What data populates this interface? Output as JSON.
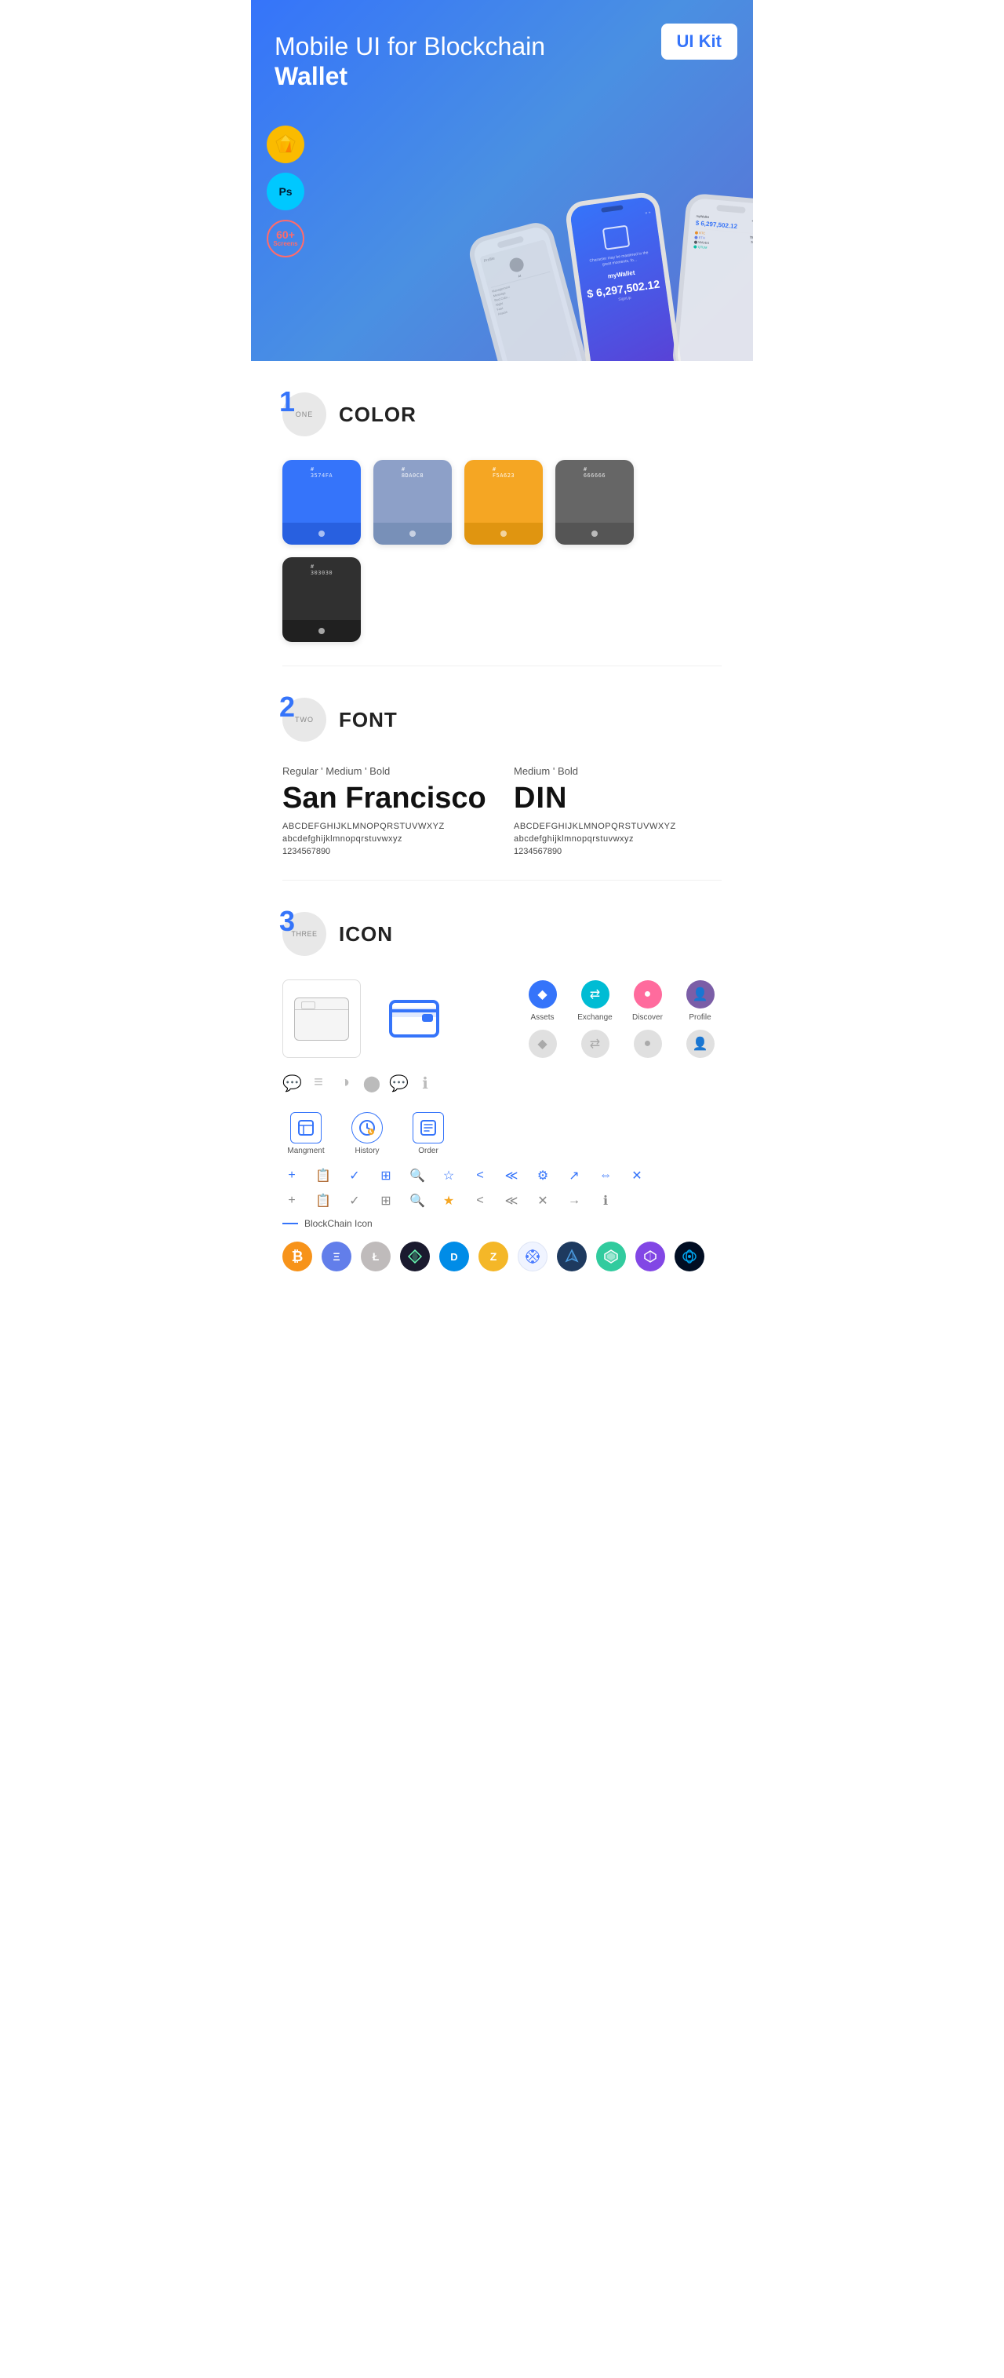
{
  "hero": {
    "title_normal": "Mobile UI for Blockchain ",
    "title_bold": "Wallet",
    "badge": "UI Kit",
    "badges": [
      {
        "icon": "sketch-icon",
        "label": "Sketch"
      },
      {
        "icon": "ps-icon",
        "label": "Ps"
      },
      {
        "icon": "screens-icon",
        "label": "60+\nScreens"
      }
    ]
  },
  "sections": {
    "color": {
      "number": "1",
      "number_label": "ONE",
      "title": "COLOR",
      "swatches": [
        {
          "hex": "#3574FA",
          "code": "#\n3574FA",
          "bottom_bg": "#2860e0"
        },
        {
          "hex": "#8DA0C8",
          "code": "#\n8DA0C8",
          "bottom_bg": "#7890b8"
        },
        {
          "hex": "#F5A623",
          "code": "#\nF5A623",
          "bottom_bg": "#e09510"
        },
        {
          "hex": "#666666",
          "code": "#\n666666",
          "bottom_bg": "#555555"
        },
        {
          "hex": "#303030",
          "code": "#\n303030",
          "bottom_bg": "#202020"
        }
      ]
    },
    "font": {
      "number": "2",
      "number_label": "TWO",
      "title": "FONT",
      "fonts": [
        {
          "style_label": "Regular ' Medium ' Bold",
          "name": "San Francisco",
          "uppercase": "ABCDEFGHIJKLMNOPQRSTUVWXYZ",
          "lowercase": "abcdefghijklmnopqrstuvwxyz",
          "numbers": "1234567890"
        },
        {
          "style_label": "Medium ' Bold",
          "name": "DIN",
          "uppercase": "ABCDEFGHIJKLMNOPQRSTUVWXYZ",
          "lowercase": "abcdefghijklmnopqrstuvwxyz",
          "numbers": "1234567890"
        }
      ]
    },
    "icon": {
      "number": "3",
      "number_label": "THREE",
      "title": "ICON",
      "nav_icons": [
        {
          "label": "Assets",
          "symbol": "◆"
        },
        {
          "label": "Exchange",
          "symbol": "⇄"
        },
        {
          "label": "Discover",
          "symbol": "●"
        },
        {
          "label": "Profile",
          "symbol": "👤"
        }
      ],
      "nav_icons_gray": [
        {
          "label": "",
          "symbol": "◆"
        },
        {
          "label": "",
          "symbol": "⇄"
        },
        {
          "label": "",
          "symbol": "●"
        },
        {
          "label": "",
          "symbol": "👤"
        }
      ],
      "tab_icons": [
        {
          "label": "Mangment",
          "type": "box"
        },
        {
          "label": "History",
          "type": "clock"
        },
        {
          "label": "Order",
          "type": "list"
        }
      ],
      "small_icons_row1": [
        "+",
        "📋",
        "✓",
        "⊞",
        "🔍",
        "☆",
        "<",
        "≪",
        "⚙",
        "↗",
        "⇔",
        "✕"
      ],
      "small_icons_row2": [
        "+",
        "📋",
        "✓",
        "⊞",
        "🔍",
        "☆",
        "<",
        "≪",
        "✕",
        "→",
        "ℹ"
      ],
      "misc_icons": [
        "💬",
        "≡",
        "◑",
        "⬤",
        "💬",
        "ℹ"
      ],
      "blockchain_label": "BlockChain Icon",
      "crypto_coins": [
        {
          "name": "Bitcoin",
          "symbol": "₿",
          "bg": "#F7931A",
          "color": "#fff"
        },
        {
          "name": "Ethereum",
          "symbol": "Ξ",
          "bg": "#627EEA",
          "color": "#fff"
        },
        {
          "name": "Litecoin",
          "symbol": "Ł",
          "bg": "#BFBBBB",
          "color": "#fff"
        },
        {
          "name": "WINGS",
          "symbol": "W",
          "bg": "#1A1A2E",
          "color": "#00ff88"
        },
        {
          "name": "Dash",
          "symbol": "D",
          "bg": "#008CE7",
          "color": "#fff"
        },
        {
          "name": "Zcash",
          "symbol": "Z",
          "bg": "#F4B728",
          "color": "#fff"
        },
        {
          "name": "Blocknet",
          "symbol": "✦",
          "bg": "#f0f4ff",
          "color": "#4A7CFF"
        },
        {
          "name": "Ardor",
          "symbol": "A",
          "bg": "#1e3a5f",
          "color": "#4A9BE0"
        },
        {
          "name": "Kyber",
          "symbol": "K",
          "bg": "#31cb9e",
          "color": "#fff"
        },
        {
          "name": "Matic",
          "symbol": "M",
          "bg": "#8247E5",
          "color": "#fff"
        },
        {
          "name": "Bancor",
          "symbol": "⬡",
          "bg": "#010E23",
          "color": "#00a4ee"
        }
      ]
    }
  }
}
